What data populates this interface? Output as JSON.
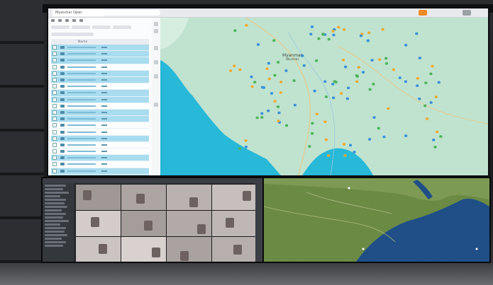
{
  "browser": {
    "tab_title": "Myanmar Operations Map",
    "address": "maps.example/dashboard"
  },
  "list_panel": {
    "header": "Name",
    "rows": 21
  },
  "map": {
    "country_label": "Myanmar",
    "country_label_sub": "(Burma)",
    "water_color": "#28b8d8",
    "land_color": "#bfe3cf",
    "marker_colors": [
      "#3a8fd9",
      "#f2a92d",
      "#4cb35a"
    ]
  },
  "vms": {
    "camera_count": 12
  },
  "satellite": {
    "sea_color": "#1f4f86",
    "land_color": "#6b8b45"
  }
}
